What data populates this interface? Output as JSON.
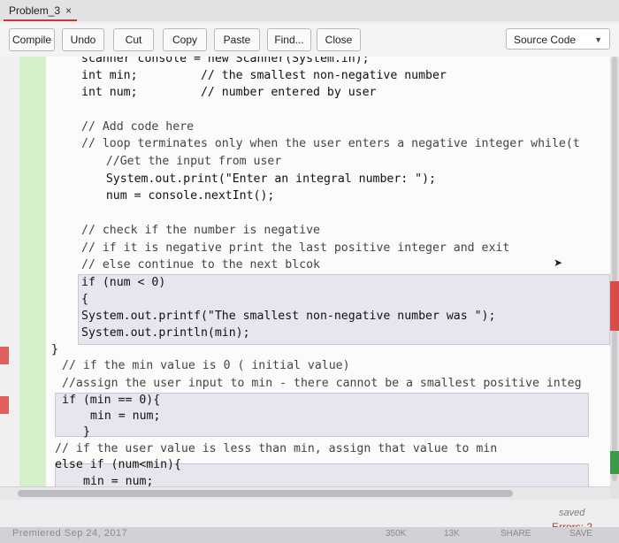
{
  "tab": {
    "title": "Problem_3",
    "close": "×"
  },
  "toolbar": {
    "compile": "Compile",
    "undo": "Undo",
    "cut": "Cut",
    "copy": "Copy",
    "paste": "Paste",
    "find": "Find...",
    "close": "Close",
    "source_select": "Source Code"
  },
  "code_lines": [
    "scanner console = new Scanner(System.in);",
    "int min;         // the smallest non-negative number",
    "int num;         // number entered by user",
    "// Add code here",
    "// loop terminates only when the user enters a negative integer while(t",
    "   //Get the input from user",
    "   System.out.print(\"Enter an integral number: \");",
    "   num = console.nextInt();",
    "// check if the number is negative",
    "// if it is negative print the last positive integer and exit",
    "// else continue to the next blcok",
    "if (num < 0)",
    "{",
    "System.out.printf(\"The smallest non-negative number was \");",
    "System.out.println(min);",
    "}",
    "// if the min value is 0 ( initial value)",
    "//assign the user input to min - there cannot be a smallest positive integ",
    "if (min == 0){",
    "min = num;",
    "}",
    "// if the user value is less than min, assign that value to min",
    "else if (num<min){",
    "min = num;"
  ],
  "status": {
    "saved": "saved",
    "errors": "Errors: 2",
    "bottom_left": "Premiered Sep 24, 2017",
    "b1": "350K",
    "b2": "13K",
    "b3": "SHARE",
    "b4": "SAVE"
  }
}
